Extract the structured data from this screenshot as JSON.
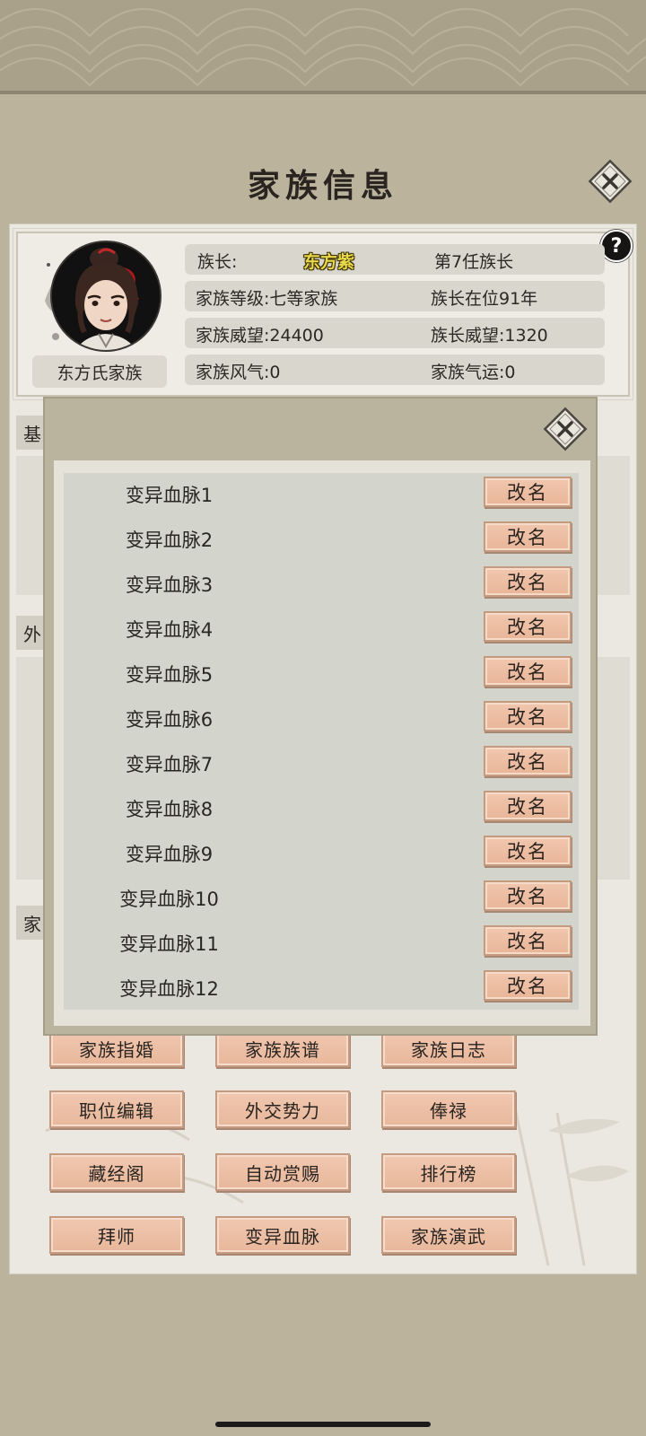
{
  "header": {
    "title": "家族信息"
  },
  "family_info": {
    "clan_name": "东方氏家族",
    "leader_label": "族长:",
    "leader_name": "东方紫",
    "leader_generation": "第7任族长",
    "family_rank": "家族等级:七等家族",
    "leader_tenure": "族长在位91年",
    "family_prestige": "家族威望:24400",
    "leader_prestige": "族长威望:1320",
    "family_custom": "家族风气:0",
    "family_fortune": "家族气运:0"
  },
  "hidden_tabs": [
    "基",
    "外",
    "家"
  ],
  "popup": {
    "rename_label": "改名",
    "bloodlines": [
      "变异血脉1",
      "变异血脉2",
      "变异血脉3",
      "变异血脉4",
      "变异血脉5",
      "变异血脉6",
      "变异血脉7",
      "变异血脉8",
      "变异血脉9",
      "变异血脉10",
      "变异血脉11",
      "变异血脉12"
    ]
  },
  "buttons": {
    "row1": [
      "家族指婚",
      "家族族谱",
      "家族日志"
    ],
    "row2": [
      "职位编辑",
      "外交势力",
      "俸禄"
    ],
    "row3": [
      "藏经阁",
      "自动赏赐",
      "排行榜"
    ],
    "row4": [
      "拜师",
      "变异血脉",
      "家族演武"
    ]
  },
  "colors": {
    "background": "#bbb39c",
    "button": "#e8b79b",
    "leader_name": "#e8d84a"
  }
}
